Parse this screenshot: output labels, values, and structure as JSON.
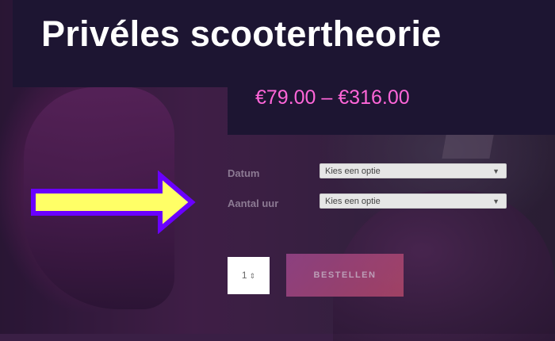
{
  "product": {
    "title": "Privéles scootertheorie",
    "price_range": "€79.00 – €316.00"
  },
  "options": {
    "date_label": "Datum",
    "date_value": "Kies een optie",
    "hours_label": "Aantal uur",
    "hours_value": "Kies een optie"
  },
  "cart": {
    "quantity": "1",
    "order_label": "BESTELLEN"
  },
  "colors": {
    "header_bg": "#1d1532",
    "price": "#ff66d9",
    "arrow_fill": "#ffff66",
    "arrow_stroke": "#6a00ff"
  },
  "icons": {
    "select_arrow": "chevron-down-icon",
    "stepper": "up-down-stepper-icon",
    "callout": "right-arrow-icon"
  }
}
